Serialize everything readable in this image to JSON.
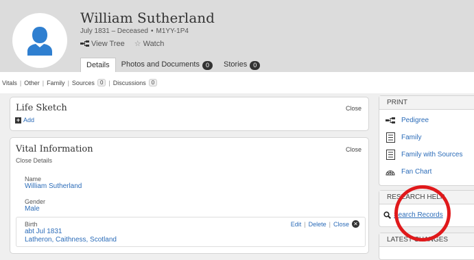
{
  "person": {
    "name": "William Sutherland",
    "dates": "July 1831 – Deceased",
    "id": "M1YY-1P4"
  },
  "header_actions": {
    "view_tree": "View Tree",
    "watch": "Watch"
  },
  "tabs": [
    {
      "label": "Details",
      "count": null
    },
    {
      "label": "Photos and Documents",
      "count": "0"
    },
    {
      "label": "Stories",
      "count": "0"
    }
  ],
  "subnav": {
    "vitals": "Vitals",
    "other": "Other",
    "family": "Family",
    "sources": "Sources",
    "sources_count": "0",
    "discussions": "Discussions",
    "discussions_count": "0"
  },
  "life_sketch": {
    "title": "Life Sketch",
    "close": "Close",
    "add": "Add"
  },
  "vital_info": {
    "title": "Vital Information",
    "close": "Close",
    "close_details": "Close Details",
    "name_label": "Name",
    "name_value": "William Sutherland",
    "gender_label": "Gender",
    "gender_value": "Male",
    "birth_label": "Birth",
    "birth_date": "abt Jul 1831",
    "birth_place": "Latheron, Caithness, Scotland",
    "edit": "Edit",
    "delete": "Delete",
    "birth_close": "Close"
  },
  "print": {
    "title": "PRINT",
    "items": [
      "Pedigree",
      "Family",
      "Family with Sources",
      "Fan Chart"
    ]
  },
  "research_help": {
    "title": "RESEARCH HELP",
    "search_records": "Search Records"
  },
  "latest_changes": {
    "title": "LATEST CHANGES"
  },
  "colors": {
    "link": "#2a6bb8",
    "avatar": "#2f7fd0",
    "highlight_ring": "#e0191b"
  }
}
